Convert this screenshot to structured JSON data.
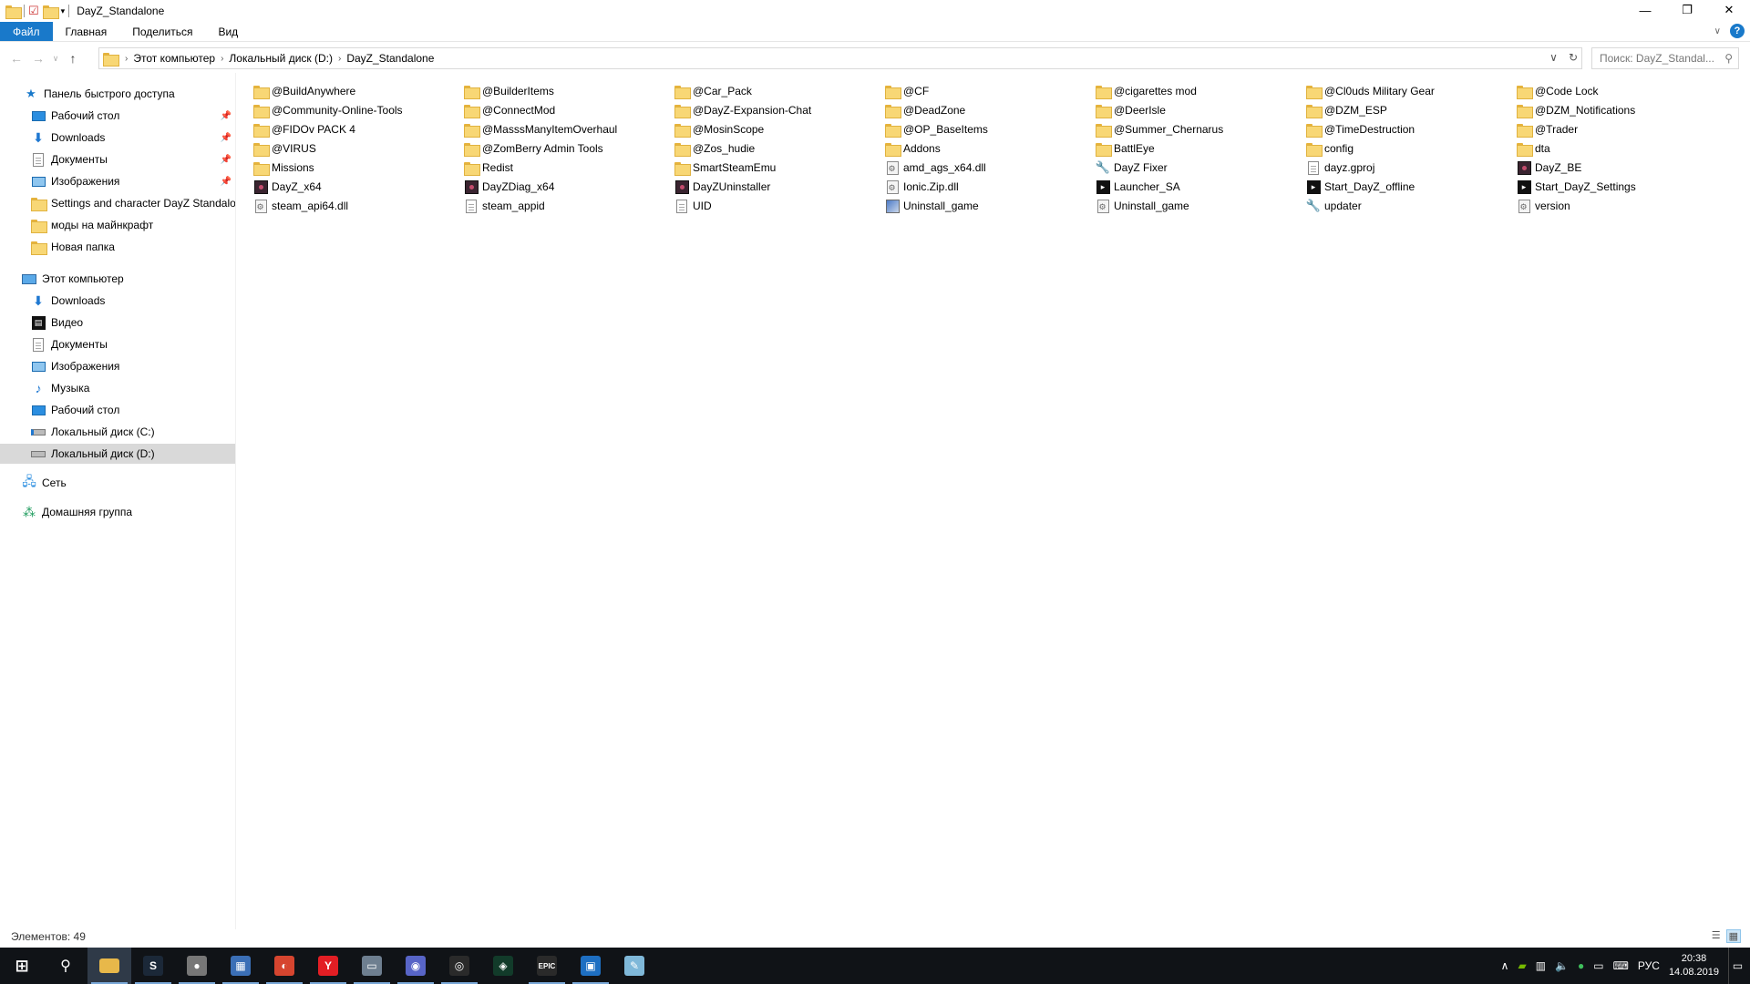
{
  "window": {
    "title": "DayZ_Standalone",
    "controls": {
      "minimize": "—",
      "maximize": "❐",
      "close": "✕"
    }
  },
  "ribbon": {
    "tabs": [
      "Файл",
      "Главная",
      "Поделиться",
      "Вид"
    ]
  },
  "address": {
    "crumbs": [
      "Этот компьютер",
      "Локальный диск (D:)",
      "DayZ_Standalone"
    ],
    "search_placeholder": "Поиск: DayZ_Standal..."
  },
  "navpane": {
    "quick_access": "Панель быстрого доступа",
    "quick_items": [
      {
        "label": "Рабочий стол",
        "icon": "desktop-icon",
        "pinned": true
      },
      {
        "label": "Downloads",
        "icon": "downloads-icon",
        "pinned": true
      },
      {
        "label": "Документы",
        "icon": "documents-icon",
        "pinned": true
      },
      {
        "label": "Изображения",
        "icon": "pictures-icon",
        "pinned": true
      },
      {
        "label": "Settings and character DayZ Standalon",
        "icon": "folder-icon",
        "pinned": false
      },
      {
        "label": "моды на майнкрафт",
        "icon": "folder-icon",
        "pinned": false
      },
      {
        "label": "Новая папка",
        "icon": "folder-icon",
        "pinned": false
      }
    ],
    "this_pc": "Этот компьютер",
    "pc_items": [
      {
        "label": "Downloads",
        "icon": "downloads-icon"
      },
      {
        "label": "Видео",
        "icon": "videos-icon"
      },
      {
        "label": "Документы",
        "icon": "documents-icon"
      },
      {
        "label": "Изображения",
        "icon": "pictures-icon"
      },
      {
        "label": "Музыка",
        "icon": "music-icon"
      },
      {
        "label": "Рабочий стол",
        "icon": "desktop-icon"
      },
      {
        "label": "Локальный диск (C:)",
        "icon": "drive-c-icon"
      },
      {
        "label": "Локальный диск (D:)",
        "icon": "drive-d-icon"
      }
    ],
    "network": "Сеть",
    "homegroup": "Домашняя группа"
  },
  "files": [
    [
      "@BuildAnywhere",
      "folder"
    ],
    [
      "@BuilderItems",
      "folder"
    ],
    [
      "@Car_Pack",
      "folder"
    ],
    [
      "@CF",
      "folder"
    ],
    [
      "@cigarettes mod",
      "folder"
    ],
    [
      "@Cl0uds Military Gear",
      "folder"
    ],
    [
      "@Code Lock",
      "folder"
    ],
    [
      "@Community-Online-Tools",
      "folder"
    ],
    [
      "@ConnectMod",
      "folder"
    ],
    [
      "@DayZ-Expansion-Chat",
      "folder"
    ],
    [
      "@DeadZone",
      "folder"
    ],
    [
      "@DeerIsle",
      "folder"
    ],
    [
      "@DZM_ESP",
      "folder"
    ],
    [
      "@DZM_Notifications",
      "folder"
    ],
    [
      "@FIDOv PACK 4",
      "folder"
    ],
    [
      "@MasssManyItemOverhaul",
      "folder"
    ],
    [
      "@MosinScope",
      "folder"
    ],
    [
      "@OP_BaseItems",
      "folder"
    ],
    [
      "@Summer_Chernarus",
      "folder"
    ],
    [
      "@TimeDestruction",
      "folder"
    ],
    [
      "@Trader",
      "folder"
    ],
    [
      "@VIRUS",
      "folder"
    ],
    [
      "@ZomBerry Admin Tools",
      "folder"
    ],
    [
      "@Zos_hudie",
      "folder"
    ],
    [
      "Addons",
      "folder"
    ],
    [
      "BattlEye",
      "folder"
    ],
    [
      "config",
      "folder"
    ],
    [
      "dta",
      "folder"
    ],
    [
      "Missions",
      "folder"
    ],
    [
      "Redist",
      "folder"
    ],
    [
      "SmartSteamEmu",
      "folder"
    ],
    [
      "amd_ags_x64.dll",
      "gear"
    ],
    [
      "DayZ Fixer",
      "wrench"
    ],
    [
      "dayz.gproj",
      "doc"
    ],
    [
      "DayZ_BE",
      "exe"
    ],
    [
      "DayZ_x64",
      "exe"
    ],
    [
      "DayZDiag_x64",
      "exe"
    ],
    [
      "DayZUninstaller",
      "exe"
    ],
    [
      "Ionic.Zip.dll",
      "gear"
    ],
    [
      "Launcher_SA",
      "black"
    ],
    [
      "Start_DayZ_offline",
      "black"
    ],
    [
      "Start_DayZ_Settings",
      "black"
    ],
    [
      "steam_api64.dll",
      "gear"
    ],
    [
      "steam_appid",
      "doc"
    ],
    [
      "UID",
      "doc"
    ],
    [
      "Uninstall_game",
      "setup"
    ],
    [
      "Uninstall_game",
      "gear"
    ],
    [
      "updater",
      "wrench"
    ],
    [
      "version",
      "gear"
    ]
  ],
  "status": {
    "count": "Элементов: 49"
  },
  "taskbar": {
    "apps": [
      {
        "name": "start-button",
        "glyph": "⊞"
      },
      {
        "name": "search-button",
        "glyph": "⚲"
      },
      {
        "name": "explorer-app",
        "glyph": ""
      },
      {
        "name": "steam-app",
        "glyph": "S"
      },
      {
        "name": "app-gray",
        "glyph": "●"
      },
      {
        "name": "app-colorful",
        "glyph": "▦"
      },
      {
        "name": "app-red-swirl",
        "glyph": "◐"
      },
      {
        "name": "yandex-app",
        "glyph": "Y"
      },
      {
        "name": "app-window",
        "glyph": "▭"
      },
      {
        "name": "app-recording",
        "glyph": "◉"
      },
      {
        "name": "obs-app",
        "glyph": "◎"
      },
      {
        "name": "app-green-target",
        "glyph": "◈"
      },
      {
        "name": "epic-games-app",
        "glyph": "EPIC"
      },
      {
        "name": "app-blue-square",
        "glyph": "▣"
      },
      {
        "name": "app-notepad",
        "glyph": "✎"
      }
    ],
    "lang": "РУС",
    "time": "20:38",
    "date": "14.08.2019"
  }
}
